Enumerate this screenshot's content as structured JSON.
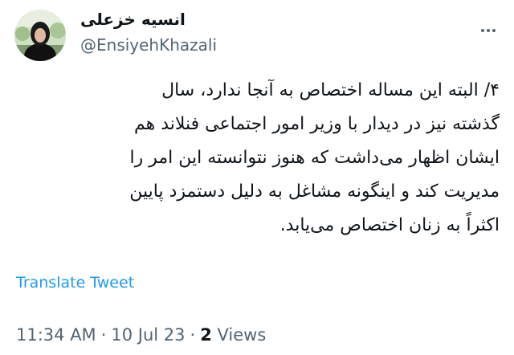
{
  "user": {
    "display_name": "انسیه خزعلی",
    "handle": "@EnsiyehKhazali",
    "avatar_icon": "profile-photo"
  },
  "menu": {
    "more_icon": "ellipsis-icon"
  },
  "tweet": {
    "text": "۴/ البته این مساله اختصاص به آنجا ندارد، سال\nگذشته نیز در دیدار با وزیر امور اجتماعی فنلاند هم\nایشان اظهار می‌داشت که هنوز نتوانسته این امر را\nمدیریت کند و اینگونه مشاغل به دلیل دستمزد پایین\nاکثراً به زنان اختصاص می‌یابد."
  },
  "translate": {
    "label": "Translate Tweet"
  },
  "meta": {
    "time": "11:34 AM",
    "separator": "·",
    "date": "10 Jul 23",
    "views_count": "2",
    "views_label": "Views"
  },
  "colors": {
    "text": "#0f1419",
    "secondary": "#536471",
    "link": "#1d9bf0"
  }
}
